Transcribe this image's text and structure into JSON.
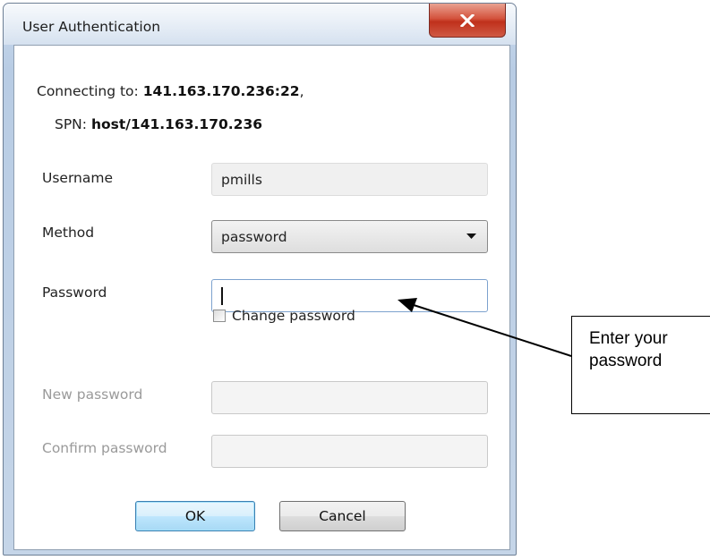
{
  "window": {
    "title": "User Authentication"
  },
  "connection": {
    "connecting_label": "Connecting to:",
    "connecting_value": "141.163.170.236:22",
    "connecting_suffix": ",",
    "spn_label": "SPN:",
    "spn_value": "host/141.163.170.236"
  },
  "form": {
    "username_label": "Username",
    "username_value": "pmills",
    "method_label": "Method",
    "method_value": "password",
    "password_label": "Password",
    "password_value": "",
    "change_password_label": "Change password",
    "change_password_checked": false,
    "new_password_label": "New password",
    "confirm_password_label": "Confirm password"
  },
  "buttons": {
    "ok_label": "OK",
    "cancel_label": "Cancel"
  },
  "annotation": {
    "line1": "Enter your",
    "line2": "password"
  },
  "icons": {
    "close": "close-icon",
    "dropdown": "chevron-down-icon"
  },
  "colors": {
    "close_button": "#c7432f",
    "ok_focus": "#3c7fb1",
    "disabled_text": "#9a9a9a"
  }
}
